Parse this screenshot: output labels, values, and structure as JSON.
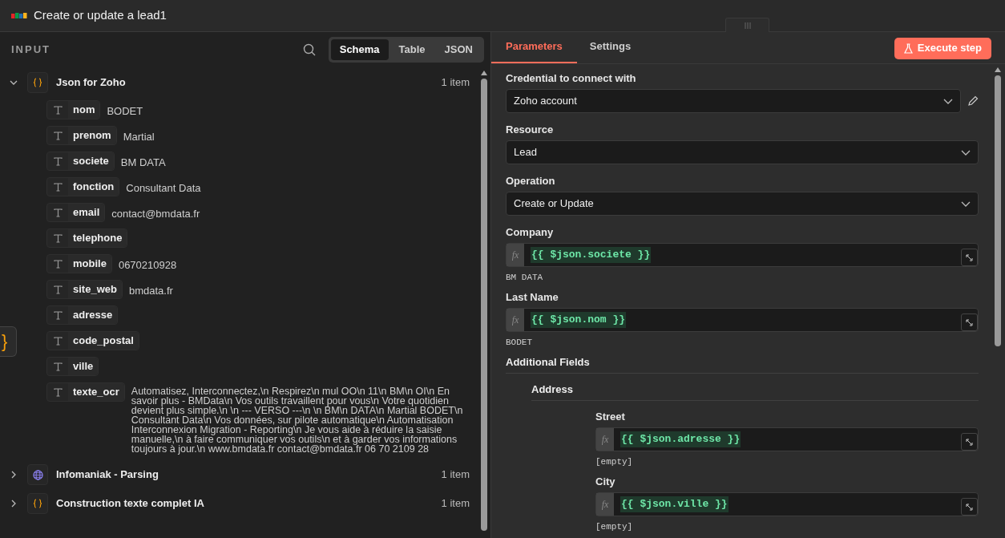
{
  "window": {
    "title": "Create or update a lead1"
  },
  "input_panel": {
    "title": "INPUT",
    "views": [
      {
        "label": "Schema",
        "selected": true
      },
      {
        "label": "Table",
        "selected": false
      },
      {
        "label": "JSON",
        "selected": false
      }
    ],
    "nodes": [
      {
        "name": "Json for Zoho",
        "kind": "object",
        "count": "1 item",
        "expanded": true,
        "fields": [
          {
            "name": "nom",
            "value": "BODET"
          },
          {
            "name": "prenom",
            "value": "Martial"
          },
          {
            "name": "societe",
            "value": "BM DATA"
          },
          {
            "name": "fonction",
            "value": "Consultant Data"
          },
          {
            "name": "email",
            "value": "contact@bmdata.fr"
          },
          {
            "name": "telephone"
          },
          {
            "name": "mobile",
            "value": "0670210928"
          },
          {
            "name": "site_web",
            "value": "bmdata.fr"
          },
          {
            "name": "adresse"
          },
          {
            "name": "code_postal"
          },
          {
            "name": "ville"
          },
          {
            "name": "texte_ocr",
            "value": "Automatisez, Interconnectez,\\n Respirez\\n mul OO\\n 11\\n BM\\n OI\\n En savoir plus - BMData\\n Vos outils travaillent pour vous\\n Votre quotidien devient plus simple.\\n \\n --- VERSO ---\\n \\n BM\\n DATA\\n Martial BODET\\n Consultant Data\\n Vos données, sur pilote automatique\\n Automatisation Interconnexion Migration - Reporting\\n Je vous aide à réduire la saisie manuelle,\\n à faire communiquer vos outils\\n et à garder vos informations toujours à jour.\\n www.bmdata.fr contact@bmdata.fr 06 70 2109 28"
          }
        ]
      },
      {
        "name": "Infomaniak - Parsing",
        "kind": "globe",
        "count": "1 item",
        "expanded": false
      },
      {
        "name": "Construction texte complet IA",
        "kind": "object",
        "count": "1 item",
        "expanded": false
      }
    ]
  },
  "parameters_panel": {
    "tabs": [
      {
        "label": "Parameters",
        "selected": true
      },
      {
        "label": "Settings",
        "selected": false
      }
    ],
    "execute_button": "Execute step",
    "params": [
      {
        "kind": "select",
        "label": "Credential to connect with",
        "value": "Zoho account",
        "editable": true
      },
      {
        "kind": "select",
        "label": "Resource",
        "value": "Lead"
      },
      {
        "kind": "select",
        "label": "Operation",
        "value": "Create or Update"
      },
      {
        "kind": "expression",
        "label": "Company",
        "marker": "fx",
        "expression": "{{ $json.societe }}",
        "result": "BM DATA"
      },
      {
        "kind": "expression",
        "label": "Last Name",
        "marker": "fx",
        "expression": "{{ $json.nom }}",
        "result": "BODET"
      },
      {
        "kind": "section",
        "label": "Additional Fields",
        "children": [
          {
            "kind": "section",
            "label": "Address",
            "children": [
              {
                "kind": "expression",
                "label": "Street",
                "marker": "fx",
                "expression": "{{ $json.adresse }}",
                "result": "[empty]"
              },
              {
                "kind": "expression",
                "label": "City",
                "marker": "fx",
                "expression": "{{ $json.ville }}",
                "result": "[empty]"
              }
            ]
          }
        ]
      }
    ]
  },
  "side_node": {
    "label": "}"
  }
}
